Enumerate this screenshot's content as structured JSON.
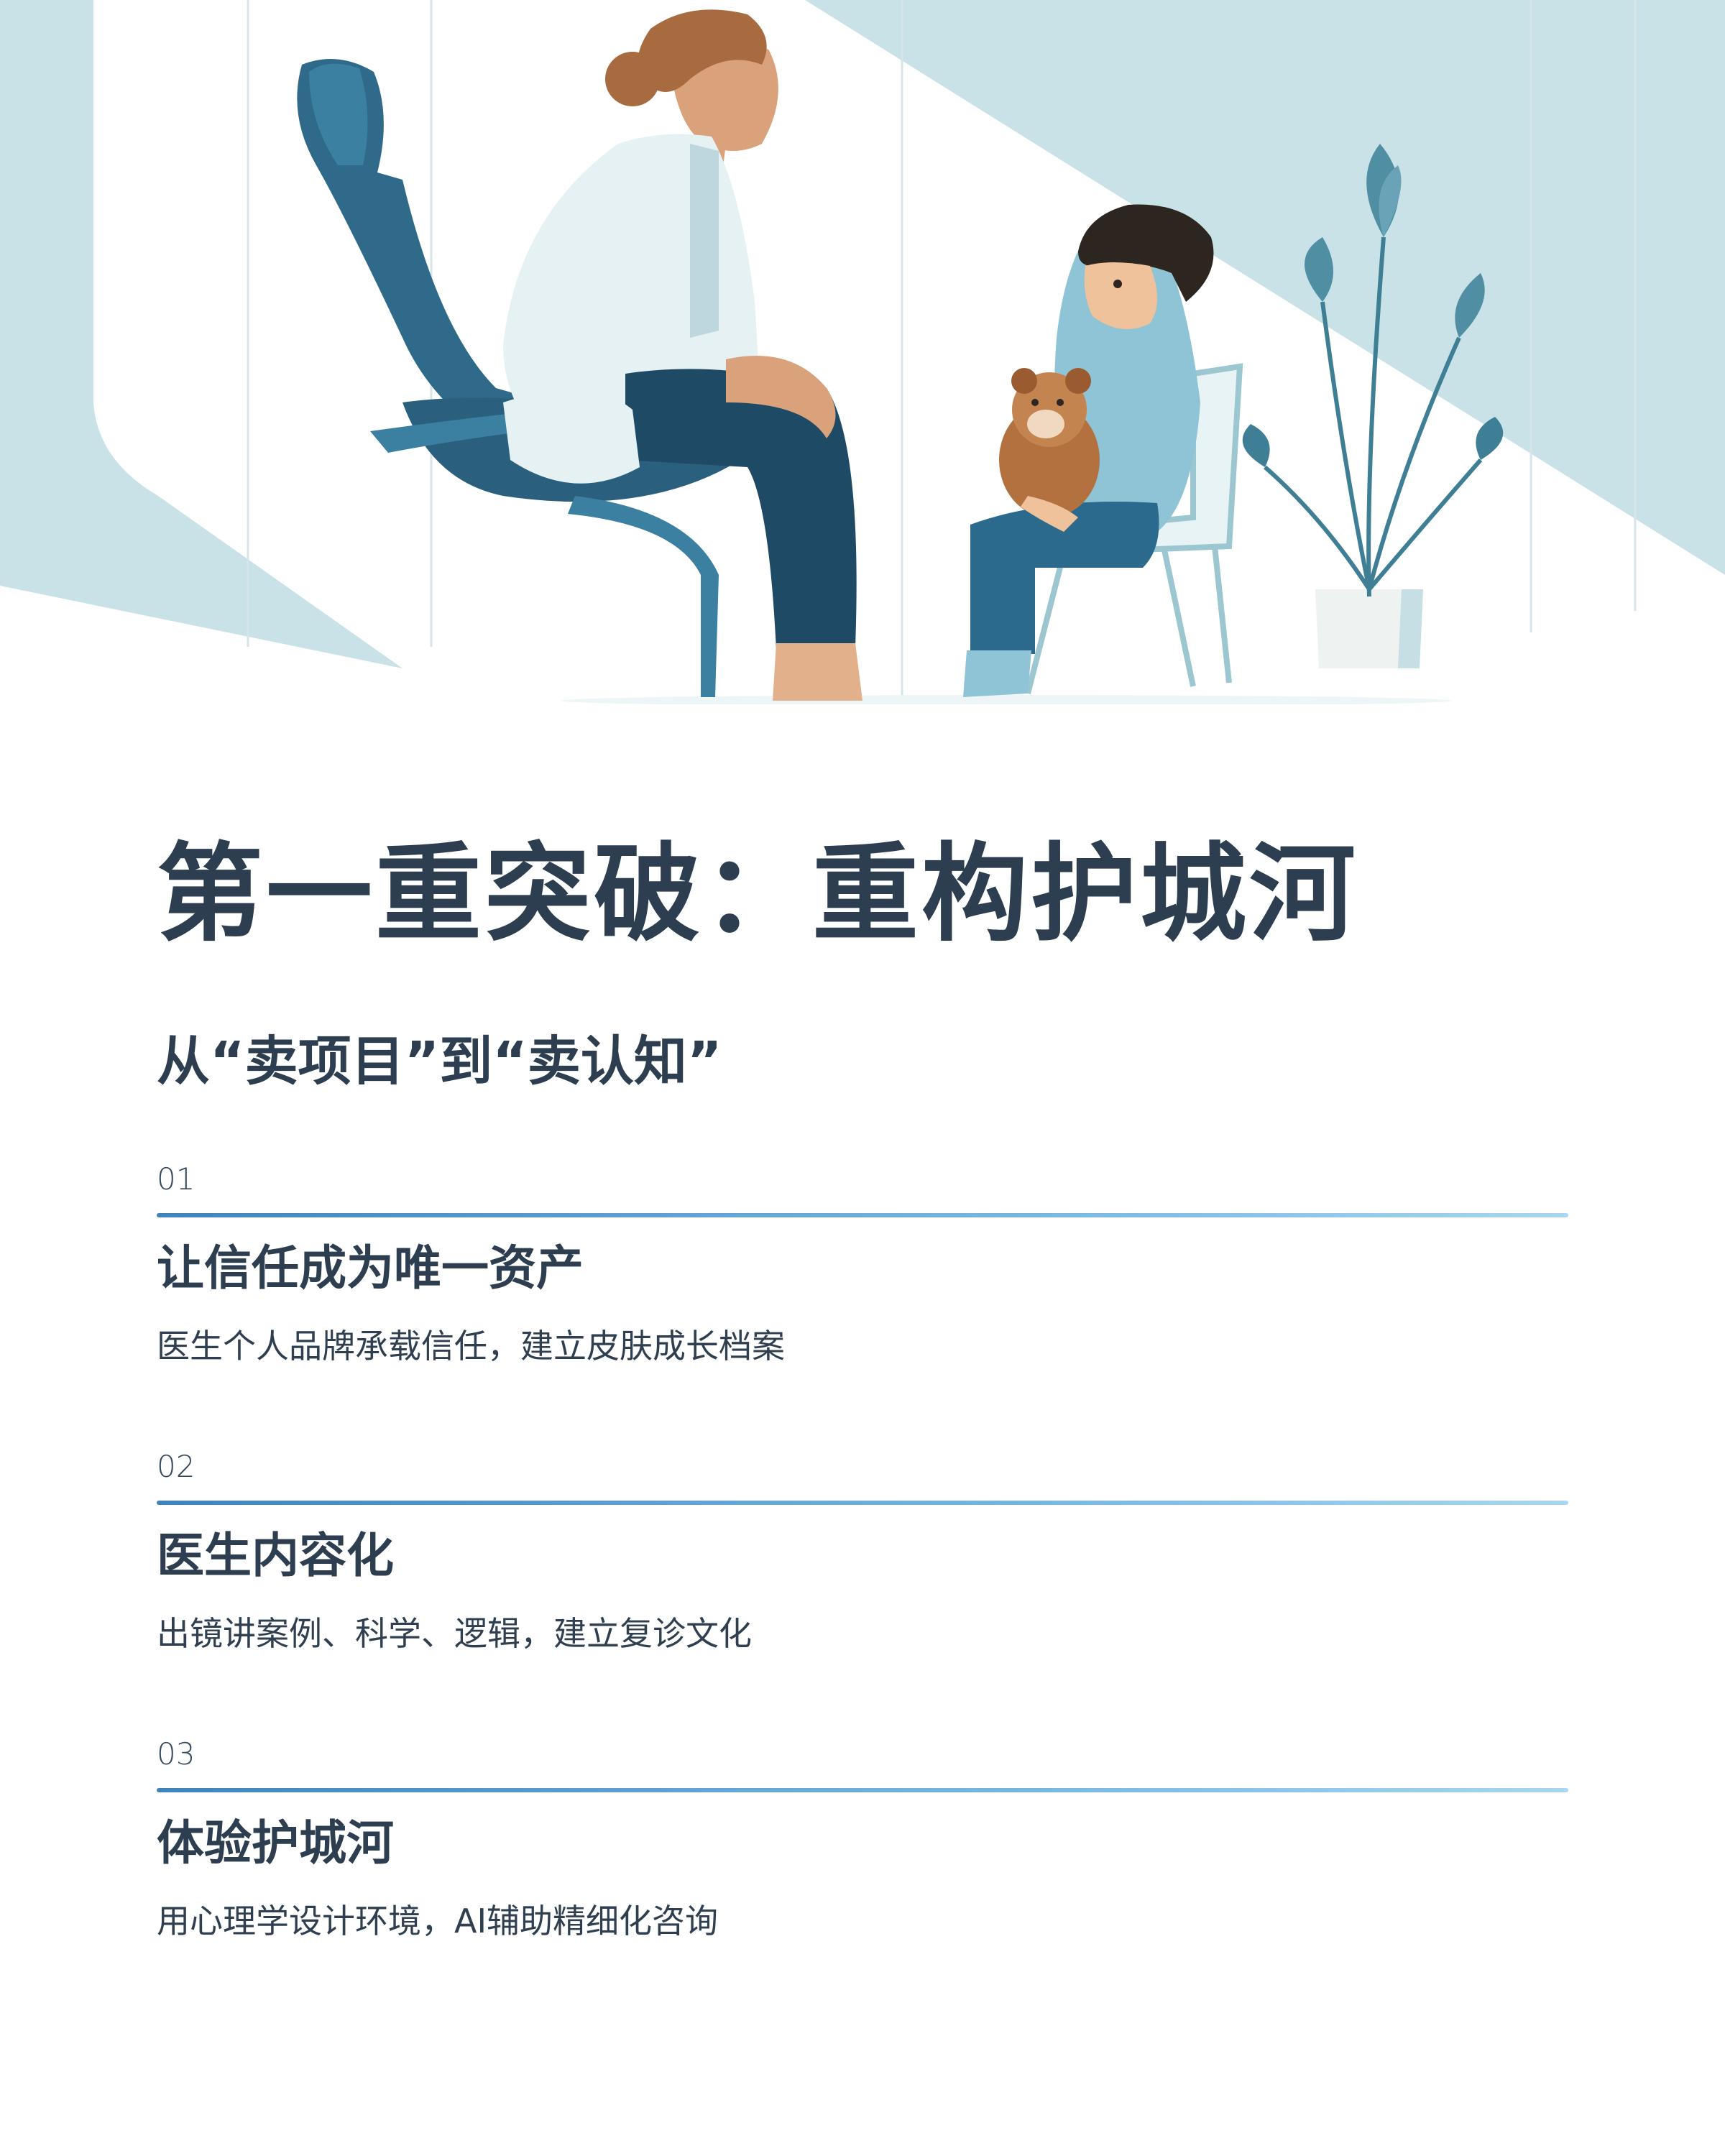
{
  "title": "第一重突破：重构护城河",
  "subtitle": "从“卖项目”到“卖认知”",
  "items": [
    {
      "number": "01",
      "title": "让信任成为唯一资产",
      "description": "医生个人品牌承载信任，建立皮肤成长档案"
    },
    {
      "number": "02",
      "title": "医生内容化",
      "description": "出镜讲案例、科学、逻辑，建立复诊文化"
    },
    {
      "number": "03",
      "title": "体验护城河",
      "description": "用心理学设计环境，AI辅助精细化咨询"
    }
  ],
  "colors": {
    "heading": "#2c3e50",
    "accent_line": "#3d84bf",
    "hero_bg": "#c9e2e7",
    "chair": "#2f6a8a"
  }
}
